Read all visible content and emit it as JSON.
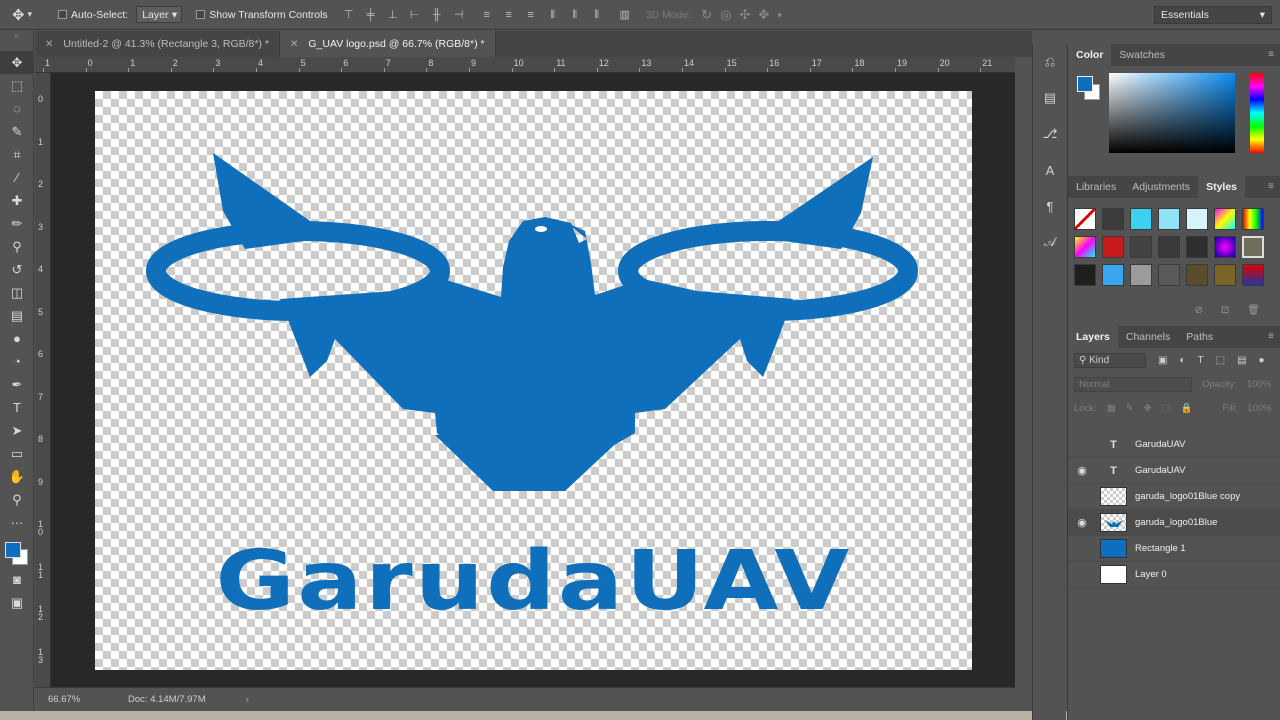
{
  "options_bar": {
    "auto_select_label": "Auto-Select:",
    "auto_select_value": "Layer",
    "show_transform_label": "Show Transform Controls",
    "three_d_mode_label": "3D Mode:",
    "workspace": "Essentials"
  },
  "doc_tabs": [
    {
      "label": "Untitled-2 @ 41.3% (Rectangle 3, RGB/8*) *",
      "active": false
    },
    {
      "label": "G_UAV logo.psd @ 66.7% (RGB/8*) *",
      "active": true
    }
  ],
  "ruler": {
    "top": [
      "1",
      "0",
      "1",
      "2",
      "3",
      "4",
      "5",
      "6",
      "7",
      "8",
      "9",
      "10",
      "11",
      "12",
      "13",
      "14",
      "15",
      "16",
      "17",
      "18",
      "19",
      "20",
      "21"
    ],
    "left": [
      "0",
      "1",
      "2",
      "3",
      "4",
      "5",
      "6",
      "7",
      "8",
      "9",
      "1\n0",
      "1\n1",
      "1\n2",
      "1\n3"
    ]
  },
  "canvas": {
    "logo_text": "GarudaUAV",
    "logo_color": "#0f6fba"
  },
  "status": {
    "zoom": "66.67%",
    "doc_size": "Doc: 4.14M/7.97M"
  },
  "color_panel": {
    "tabs": [
      "Color",
      "Swatches"
    ],
    "foreground": "#0d6fbf",
    "background": "#ffffff"
  },
  "styles_panel": {
    "tabs": [
      "Libraries",
      "Adjustments",
      "Styles"
    ]
  },
  "layers_panel": {
    "tabs": [
      "Layers",
      "Channels",
      "Paths"
    ],
    "filter_kind": "Kind",
    "blend_mode": "Normal",
    "opacity_label": "Opacity:",
    "opacity_value": "100%",
    "lock_label": "Lock:",
    "fill_label": "Fill:",
    "fill_value": "100%",
    "layers": [
      {
        "name": "GarudaUAV",
        "type": "text",
        "visible": false
      },
      {
        "name": "GarudaUAV",
        "type": "text",
        "visible": true
      },
      {
        "name": "garuda_logo01Blue copy",
        "type": "checker",
        "visible": false
      },
      {
        "name": "garuda_logo01Blue",
        "type": "checker",
        "visible": true
      },
      {
        "name": "Rectangle 1",
        "type": "blue",
        "visible": false
      },
      {
        "name": "Layer 0",
        "type": "white",
        "visible": false
      }
    ]
  }
}
